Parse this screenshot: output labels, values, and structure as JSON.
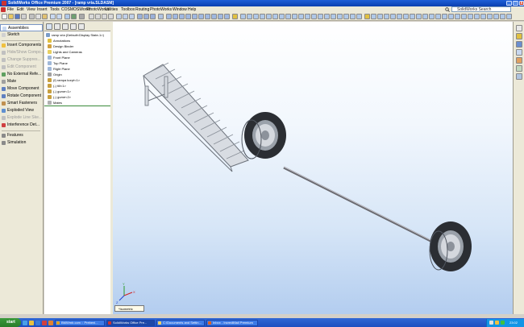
{
  "titlebar": {
    "title": "SolidWorks Office Premium 2007 - [ramp vria.SLDASM]",
    "buttons": [
      "_",
      "□",
      "x"
    ]
  },
  "menu": {
    "items": [
      "File",
      "Edit",
      "View",
      "Insert",
      "Tools",
      "COSMOSWorks",
      "PhotoWorks",
      "Utilities",
      "Toolbox",
      "Routing",
      "PhotoWorks",
      "Window",
      "Help"
    ],
    "search_text": "SolidWorks Search"
  },
  "command_manager": {
    "items": [
      {
        "label": "Assemblies",
        "state": "selected",
        "color": "#c8d8f0"
      },
      {
        "label": "Sketch",
        "state": "normal",
        "color": "#d0d0d0"
      },
      {
        "label": "Insert Components",
        "state": "normal",
        "color": "#f0c040"
      },
      {
        "label": "Hide/Show Compo...",
        "state": "disabled",
        "color": "#c0c0c0"
      },
      {
        "label": "Change Suppres...",
        "state": "disabled",
        "color": "#c0c0c0"
      },
      {
        "label": "Edit Component",
        "state": "disabled",
        "color": "#c0c0c0"
      },
      {
        "label": "No External Refe...",
        "state": "normal",
        "color": "#60a060"
      },
      {
        "label": "Mate",
        "state": "normal",
        "color": "#a0a0a0"
      },
      {
        "label": "Move Component",
        "state": "normal",
        "color": "#6080c0"
      },
      {
        "label": "Rotate Component",
        "state": "normal",
        "color": "#6080c0"
      },
      {
        "label": "Smart Fasteners",
        "state": "normal",
        "color": "#c09050"
      },
      {
        "label": "Exploded View",
        "state": "normal",
        "color": "#6090d0"
      },
      {
        "label": "Explode Line Ske...",
        "state": "disabled",
        "color": "#c0c0c0"
      },
      {
        "label": "Interference Det...",
        "state": "normal",
        "color": "#d04040"
      },
      {
        "label": "Features",
        "state": "normal",
        "color": "#8a8a8a"
      },
      {
        "label": "Simulation",
        "state": "normal",
        "color": "#8a8a8a"
      }
    ]
  },
  "feature_tree": {
    "items": [
      {
        "label": "ramp vria (Default<Display State-1>)",
        "level": 0,
        "color": "#7a9cc8"
      },
      {
        "label": "Annotations",
        "level": 1,
        "color": "#e0c040"
      },
      {
        "label": "Design Binder",
        "level": 1,
        "color": "#d0a040"
      },
      {
        "label": "Lights and Cameras",
        "level": 1,
        "color": "#e8d060"
      },
      {
        "label": "Front Plane",
        "level": 1,
        "color": "#a0b8d8"
      },
      {
        "label": "Top Plane",
        "level": 1,
        "color": "#a0b8d8"
      },
      {
        "label": "Right Plane",
        "level": 1,
        "color": "#a0b8d8"
      },
      {
        "label": "Origin",
        "level": 1,
        "color": "#a0a0a0"
      },
      {
        "label": "(f) rampa korpt<1>",
        "level": 1,
        "color": "#c8a040"
      },
      {
        "label": "(-) tili<1>",
        "level": 1,
        "color": "#c8a040"
      },
      {
        "label": "(-) gume<1>",
        "level": 1,
        "color": "#c8a040"
      },
      {
        "label": "(-) gume<2>",
        "level": 1,
        "color": "#c8a040"
      },
      {
        "label": "Mates",
        "level": 1,
        "color": "#b0b0b0"
      }
    ]
  },
  "graphics": {
    "view_orientation": "*Isometric",
    "triad_axes": [
      "X",
      "Y",
      "Z"
    ],
    "background_colors": [
      "#ffffff",
      "#b3cdef"
    ]
  },
  "taskbar": {
    "start_label": "start",
    "tasks": [
      {
        "label": "BMWmb.com :: Prebeni...",
        "active": false,
        "color": "#e0a020"
      },
      {
        "label": "SolidWorks Office Pre...",
        "active": true,
        "color": "#d03030"
      },
      {
        "label": "C:\\Documents and Settin...",
        "active": false,
        "color": "#f0d060"
      },
      {
        "label": "Inbox - IncrediMail Premium",
        "active": false,
        "color": "#e06020"
      }
    ],
    "clock": "23:02"
  }
}
